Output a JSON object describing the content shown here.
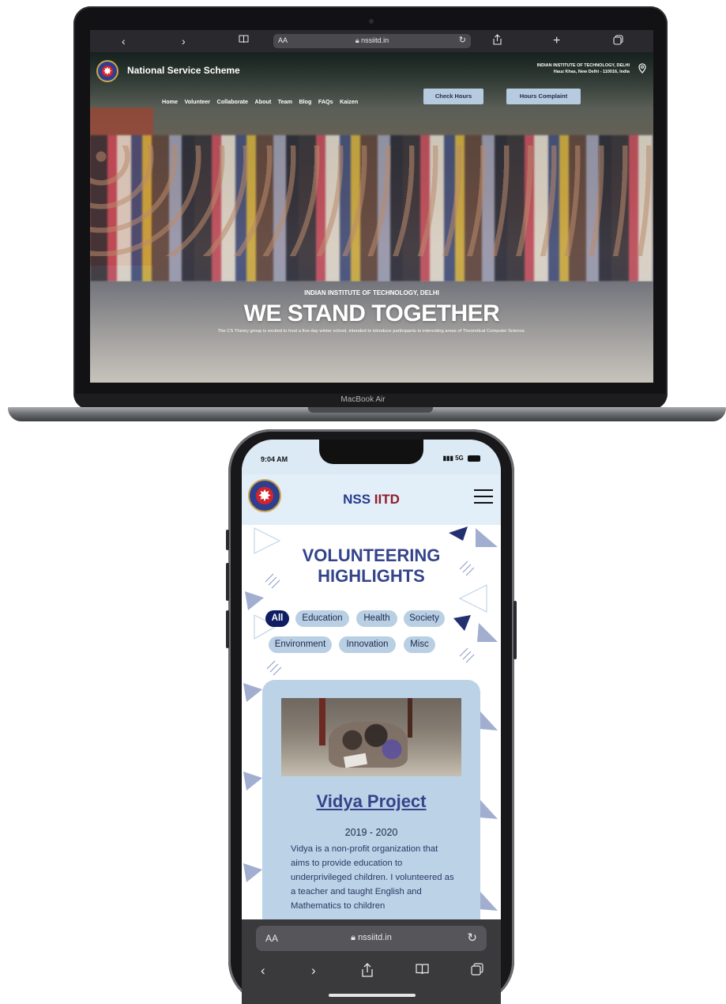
{
  "laptop": {
    "browser": {
      "aa": "AA",
      "url": "nssiitd.in",
      "icons": [
        "back-icon",
        "forward-icon",
        "book-icon",
        "reload-icon",
        "share-icon",
        "new-tab-icon",
        "tabs-icon"
      ]
    },
    "site": {
      "title": "National Service Scheme",
      "address_line1": "INDIAN INSTITUTE OF TECHNOLOGY, DELHI",
      "address_line2": "Hauz Khas, New Delhi - 110016, India",
      "nav": [
        "Home",
        "Volunteer",
        "Collaborate",
        "About",
        "Team",
        "Blog",
        "FAQs",
        "Kaizen"
      ],
      "check_hours": "Check Hours",
      "hours_complaint": "Hours Complaint",
      "hero_subtitle": "INDIAN INSTITUTE OF TECHNOLOGY, DELHI",
      "hero_title": "WE STAND TOGETHER",
      "hero_description": "The CS Theory group is excited to host a five-day winter school, intended to introduce participants to interesting areas of Theoretical Computer Science."
    },
    "device_label": "MacBook Air"
  },
  "phone": {
    "status": {
      "time": "9:04 AM",
      "network": "5G"
    },
    "header": {
      "title_part1": "NSS ",
      "title_part2": "IITD"
    },
    "section_title_line1": "VOLUNTEERING",
    "section_title_line2": "HIGHLIGHTS",
    "filters": [
      {
        "label": "All",
        "active": true
      },
      {
        "label": "Education",
        "active": false
      },
      {
        "label": "Health",
        "active": false
      },
      {
        "label": "Society",
        "active": false
      },
      {
        "label": "Environment",
        "active": false
      },
      {
        "label": "Innovation",
        "active": false
      },
      {
        "label": "Misc",
        "active": false
      }
    ],
    "card": {
      "title": "Vidya Project",
      "years": "2019 - 2020",
      "description": "Vidya is a non-profit organization that aims to provide education to underprivileged children. I volunteered as a teacher and taught English and Mathematics to children"
    },
    "browser": {
      "aa": "AA",
      "url": "nssiitd.in"
    }
  },
  "colors": {
    "brand_blue": "#34448a",
    "brand_dark_blue": "#0f1d64",
    "brand_red": "#8f1f2c",
    "chip_bg": "#b9cfe4",
    "card_bg": "#bcd2e7",
    "header_btn_bg": "#b6cbe0"
  }
}
